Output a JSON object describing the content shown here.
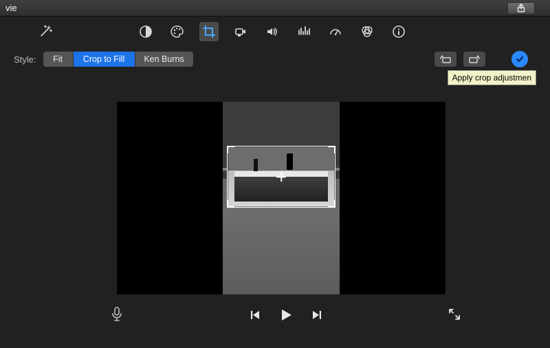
{
  "menubar": {
    "title": "vie"
  },
  "toolbar": {
    "tools": [
      "balance",
      "color",
      "crop",
      "video",
      "audio",
      "eq",
      "speed",
      "color-filter",
      "info"
    ],
    "active_tool": "crop"
  },
  "style_row": {
    "label": "Style:",
    "options": [
      "Fit",
      "Crop to Fill",
      "Ken Burns"
    ],
    "selected_index": 1,
    "apply_tooltip": "Apply crop adjustmen"
  }
}
